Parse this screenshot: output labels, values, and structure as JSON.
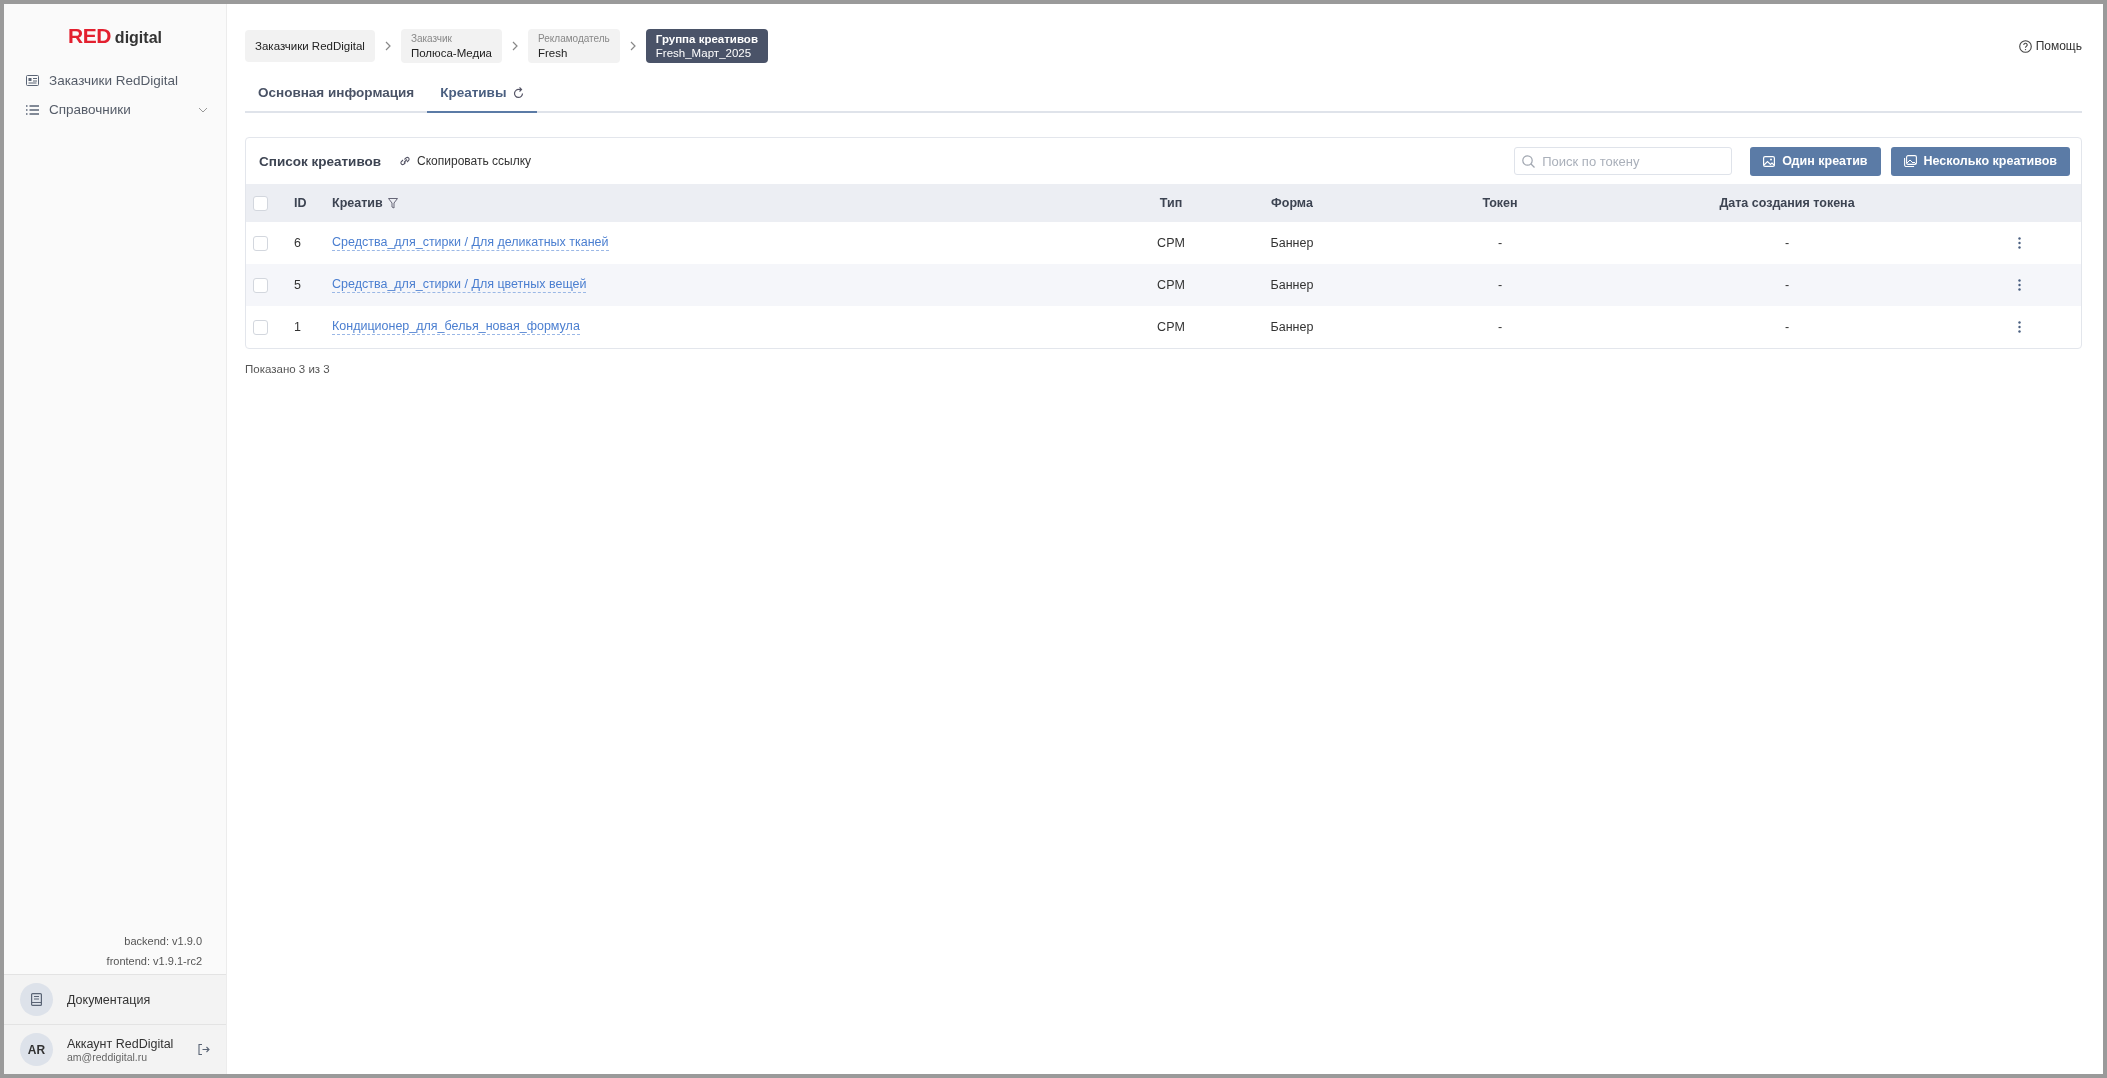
{
  "logo": {
    "brand": "RED",
    "suffix": "digital"
  },
  "sidebar": {
    "items": [
      {
        "kind": "link",
        "label": "Заказчики RedDigital",
        "selected": false
      },
      {
        "kind": "group",
        "label": "Справочники",
        "expanded": false
      }
    ],
    "versions": [
      "backend: v1.9.0",
      "frontend: v1.9.1-rc2"
    ],
    "docs": "Документация",
    "account": {
      "initials": "AR",
      "name": "Аккаунт RedDigital",
      "email": "am@reddigital.ru"
    }
  },
  "breadcrumbs": [
    {
      "label": "Заказчики RedDigital",
      "selected": false
    },
    {
      "caption": "Заказчик",
      "label": "Полюса-Медиа",
      "selected": false
    },
    {
      "caption": "Рекламодатель",
      "label": "Fresh",
      "selected": false
    },
    {
      "caption": "Группа креативов",
      "label": "Fresh_Март_2025",
      "selected": true
    }
  ],
  "help": "Помощь",
  "tabs": [
    {
      "label": "Основная информация",
      "selected": false,
      "refresh": false
    },
    {
      "label": "Креативы",
      "selected": true,
      "refresh": true
    }
  ],
  "card": {
    "title": "Список креативов",
    "copy_link": "Скопировать ссылку",
    "search": {
      "placeholder": "Поиск по токену"
    },
    "buttons": [
      "Один креатив",
      "Несколько креативов"
    ]
  },
  "table": {
    "all_checked": false,
    "columns": [
      "ID",
      "Креатив",
      "Тип",
      "Форма",
      "Токен",
      "Дата создания токена"
    ],
    "rows": [
      {
        "checked": false,
        "id": "6",
        "creative": "Средства_для_стирки / Для деликатных тканей",
        "type": "CPM",
        "form": "Баннер",
        "token": "-",
        "date": "-"
      },
      {
        "checked": false,
        "id": "5",
        "creative": "Средства_для_стирки / Для цветных вещей",
        "type": "CPM",
        "form": "Баннер",
        "token": "-",
        "date": "-"
      },
      {
        "checked": false,
        "id": "1",
        "creative": "Кондиционер_для_белья_новая_формула",
        "type": "CPM",
        "form": "Баннер",
        "token": "-",
        "date": "-"
      }
    ]
  },
  "footer": "Показано 3 из 3"
}
